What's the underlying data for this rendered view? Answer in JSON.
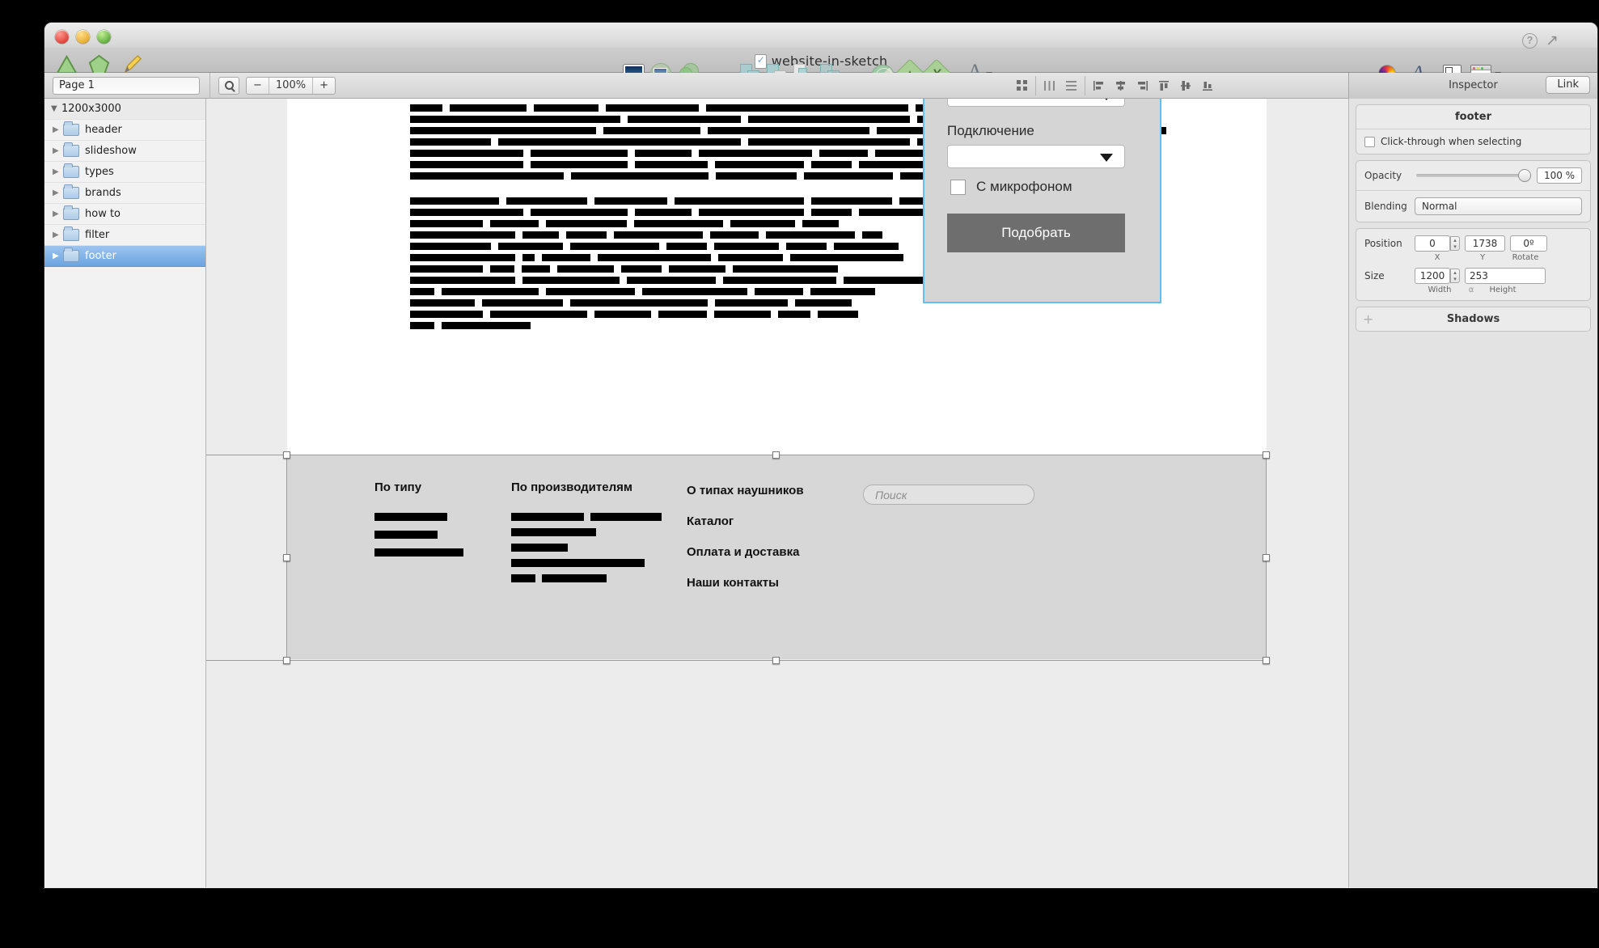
{
  "window": {
    "title": "website-in-sketch",
    "traffic_lights": [
      "close",
      "minimize",
      "zoom"
    ]
  },
  "toolbar": {
    "left_tools": [
      "triangle-tool",
      "pentagon-tool",
      "pencil-tool"
    ],
    "insert_group": [
      "image-icon",
      "image-mask-icon",
      "circles-icon"
    ],
    "boolean_group": [
      "union-icon",
      "subtract-icon",
      "intersect-icon",
      "difference-icon"
    ],
    "path_group": [
      "flatten-icon",
      "join-icon",
      "split-icon"
    ],
    "text_label": "A",
    "right_group": [
      "color-wheel-icon",
      "fonts-icon",
      "pixels-icon",
      "panels-icon"
    ],
    "help_label": "?"
  },
  "subbar": {
    "page_name": "Page 1",
    "zoom_minus": "−",
    "zoom_value": "100%",
    "zoom_plus": "+",
    "inspector_label": "Inspector",
    "link_label": "Link",
    "align_icons": [
      "grid-icon",
      "distribute-horizontal-icon",
      "distribute-vertical-icon",
      "align-left-icon",
      "align-center-icon",
      "align-right-icon",
      "align-top-icon",
      "align-middle-icon",
      "align-bottom-icon"
    ]
  },
  "layers": {
    "artboard": {
      "label": "1200x3000",
      "expanded": true
    },
    "items": [
      {
        "label": "header",
        "selected": false
      },
      {
        "label": "slideshow",
        "selected": false
      },
      {
        "label": "types",
        "selected": false
      },
      {
        "label": "brands",
        "selected": false
      },
      {
        "label": "how to",
        "selected": false
      },
      {
        "label": "filter",
        "selected": false
      },
      {
        "label": "footer",
        "selected": true
      }
    ]
  },
  "canvas": {
    "filter_card": {
      "select_top_value": "",
      "connection_label": "Подключение",
      "connection_value": "",
      "checkbox_label": "С микрофоном",
      "checkbox_checked": false,
      "submit_label": "Подобрать"
    },
    "paragraph_blocks": [
      {
        "name": "paragraph-1",
        "lines": [
          [
            40,
            95,
            80,
            115,
            250,
            230
          ],
          [
            260,
            140,
            200,
            150,
            60
          ],
          [
            230,
            120,
            200,
            90,
            130,
            120
          ],
          [
            100,
            300,
            200,
            110,
            105
          ],
          [
            140,
            120,
            70,
            140,
            60,
            70,
            40
          ],
          [
            140,
            120,
            90,
            110,
            50,
            110
          ],
          [
            190,
            170,
            100,
            110,
            90
          ]
        ]
      },
      {
        "name": "paragraph-2",
        "lines": [
          [
            110,
            100,
            90,
            160,
            100,
            120
          ],
          [
            140,
            120,
            70,
            130,
            50,
            90
          ],
          [
            90,
            60,
            100,
            110,
            80,
            45
          ],
          [
            130,
            45,
            50,
            110,
            60,
            110,
            25
          ],
          [
            100,
            80,
            110,
            50,
            80,
            50,
            80
          ],
          [
            130,
            15,
            60,
            140,
            80,
            140
          ],
          [
            90,
            30,
            35,
            70,
            50,
            70,
            130
          ],
          [
            130,
            120,
            110,
            140,
            110
          ],
          [
            30,
            120,
            110,
            130,
            60,
            80
          ],
          [
            80,
            100,
            170,
            90,
            70
          ],
          [
            90,
            120,
            70,
            60,
            70,
            40,
            50
          ],
          [
            30,
            110
          ]
        ]
      }
    ],
    "footer": {
      "col1_title": "По типу",
      "col1_bars": [
        90,
        78,
        110
      ],
      "col2_title": "По производителям",
      "col2_bars": [
        [
          90,
          88
        ],
        [
          105
        ],
        [
          70
        ],
        [
          165
        ],
        [
          30,
          80
        ]
      ],
      "links": [
        "О типах наушников",
        "Каталог",
        "Оплата и доставка",
        "Наши контакты"
      ],
      "search_placeholder": "Поиск"
    }
  },
  "inspector": {
    "title": "footer",
    "click_through_label": "Click-through when selecting",
    "click_through_checked": false,
    "opacity_label": "Opacity",
    "opacity_value": "100 %",
    "blending_label": "Blending",
    "blending_value": "Normal",
    "position_label": "Position",
    "position_x": "0",
    "position_y": "1738",
    "position_rotate": "0º",
    "label_x": "X",
    "label_y": "Y",
    "label_rotate": "Rotate",
    "size_label": "Size",
    "size_width": "1200",
    "size_height": "253",
    "label_width": "Width",
    "label_height": "Height",
    "shadows_label": "Shadows",
    "add_glyph": "+"
  },
  "colors": {
    "selection_blue": "#5ec1f0",
    "layer_selected": "#6ba4e0",
    "footer_bg": "#d7d7d7",
    "button_gray": "#6e6e6e"
  }
}
